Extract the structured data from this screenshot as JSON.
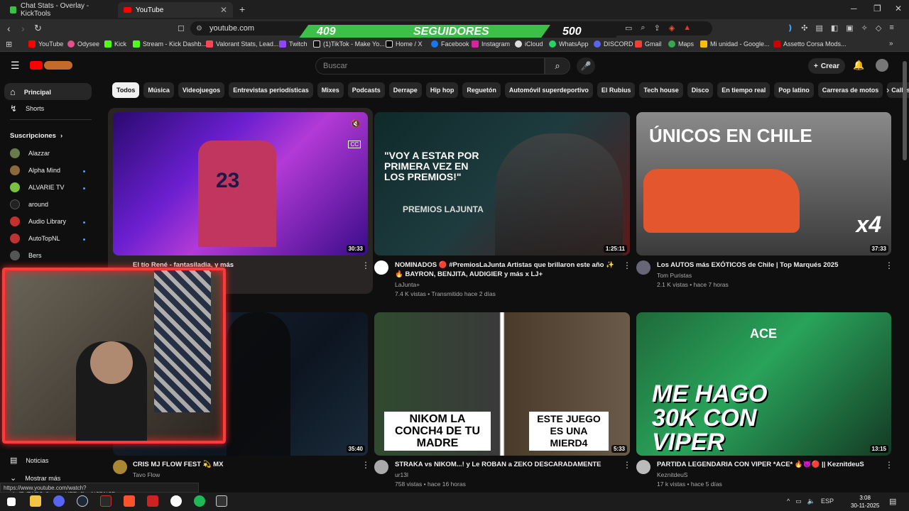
{
  "browser": {
    "tabs": [
      {
        "title": "Chat Stats - Overlay - KickTools",
        "active": false
      },
      {
        "title": "YouTube",
        "active": true
      }
    ],
    "new_tab": "+",
    "url": "youtube.com",
    "bookmarks": [
      "YouTube",
      "Odysee",
      "Kick",
      "Stream - Kick Dashb...",
      "Valorant Stats, Lead...",
      "Twitch",
      "(1)TikTok - Make Yo...",
      "Home / X",
      "Facebook",
      "Instagram",
      "iCloud",
      "WhatsApp",
      "DISCORD",
      "Gmail",
      "Maps",
      "Mi unidad - Google...",
      "Assetto Corsa Mods..."
    ],
    "status_url": "https://www.youtube.com/watch?v=pkef7sZWD3c&pp=ugUEEgJlcw%3D%3D"
  },
  "overlay": {
    "count": "409",
    "label": "SEGUIDORES",
    "goal": "500"
  },
  "youtube": {
    "search_placeholder": "Buscar",
    "create_label": "Crear",
    "chips": [
      "Todos",
      "Música",
      "Videojuegos",
      "Entrevistas periodísticas",
      "Mixes",
      "Podcasts",
      "Derrape",
      "Hip hop",
      "Reguetón",
      "Automóvil superdeportivo",
      "El Rubius",
      "Tech house",
      "Disco",
      "En tiempo real",
      "Pop latino",
      "Carreras de motos",
      "Calles"
    ],
    "sidebar": {
      "home": "Principal",
      "shorts": "Shorts",
      "subs_header": "Suscripciones",
      "subs": [
        "Alazzar",
        "Alpha Mind",
        "ALVARIE TV",
        "around",
        "Audio Library",
        "AutoTopNL",
        "Bers"
      ],
      "news": "Noticias",
      "more": "Mostrar más"
    },
    "videos": [
      {
        "title": "El tío René - fantasiladia, y más",
        "channel": "",
        "meta": "",
        "duration": "30:33"
      },
      {
        "title": "NOMINADOS 🔴 #PremiosLaJunta Artistas que brillaron este año ✨🔥 BAYRON, BENJITA, AUDIGIER y más x LJ+",
        "channel": "LaJunta+",
        "meta": "7.4 K vistas • Transmitido hace 2 días",
        "duration": "1:25:11",
        "overlay_text": "\"VOY A ESTAR POR PRIMERA VEZ EN LOS PREMIOS!\"",
        "sub_text": "PREMIOS LAJUNTA"
      },
      {
        "title": "Los AUTOS más EXÓTICOS de Chile | Top Marqués 2025",
        "channel": "Tom Puristas",
        "meta": "2.1 K vistas • hace 7 horas",
        "duration": "37:33",
        "overlay_text": "ÚNICOS EN CHILE",
        "badge": "x4"
      },
      {
        "title": "CRIS MJ FLOW FEST 💫 MX",
        "channel": "Tavo Flow",
        "meta": "",
        "duration": "35:40"
      },
      {
        "title": "STRAKA vs NIKOM...! y Le ROBAN a ZEKO DESCARADAMENTE",
        "channel": "ur13l",
        "meta": "758 vistas • hace 16 horas",
        "duration": "5:33",
        "overlay_left": "NIKOM LA CONCH4 DE TU MADRE",
        "overlay_right": "ESTE JUEGO ES UNA MIERD4"
      },
      {
        "title": "PARTIDA LEGENDARIA CON VIPER *ACE* 🔥😈🔴 || KeznitdeuS",
        "channel": "KeznitdeuS",
        "meta": "17 k vistas • hace 5 días",
        "duration": "13:15",
        "overlay_text": "ME HAGO 30K CON VIPER",
        "ace": "ACE"
      }
    ]
  },
  "taskbar": {
    "lang": "ESP",
    "time": "3:08",
    "date": "30-11-2025"
  }
}
